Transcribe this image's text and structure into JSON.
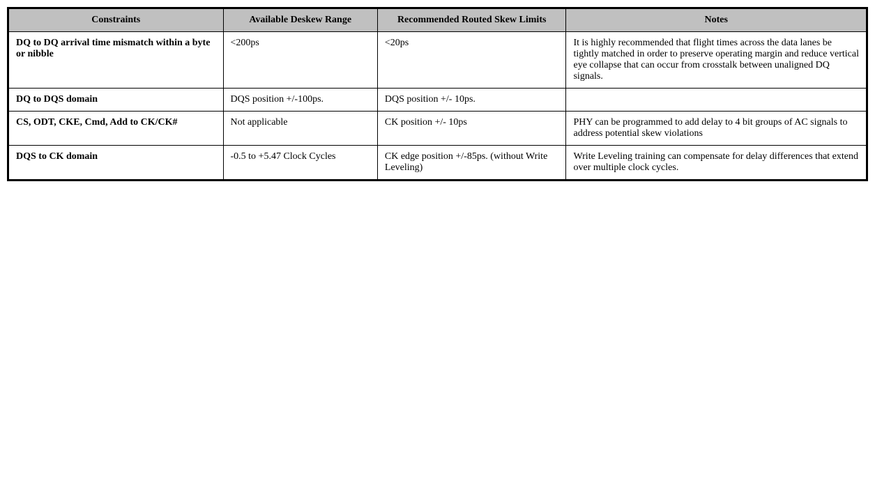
{
  "table": {
    "headers": [
      {
        "id": "constraints",
        "label": "Constraints"
      },
      {
        "id": "deskew",
        "label": "Available Deskew Range"
      },
      {
        "id": "skew",
        "label": "Recommended Routed Skew Limits"
      },
      {
        "id": "notes",
        "label": "Notes"
      }
    ],
    "rows": [
      {
        "constraint": "DQ to DQ arrival time mismatch within a byte or nibble",
        "deskew": "<200ps",
        "skew": "<20ps",
        "notes": "It is highly recommended that flight times across the data lanes be tightly matched in order to preserve operating margin and reduce vertical eye collapse that can occur from crosstalk between unaligned DQ signals."
      },
      {
        "constraint": "DQ to DQS domain",
        "deskew": "DQS position +/-100ps.",
        "skew": "DQS position +/- 10ps.",
        "notes": ""
      },
      {
        "constraint": "CS, ODT, CKE, Cmd, Add to CK/CK#",
        "deskew": "Not applicable",
        "skew": "CK position +/- 10ps",
        "notes": "PHY can be programmed to add delay to 4 bit groups of AC signals to address potential skew violations"
      },
      {
        "constraint": "DQS to CK domain",
        "deskew": "-0.5 to +5.47 Clock Cycles",
        "skew": "CK edge position +/-85ps. (without Write Leveling)",
        "notes": "Write Leveling training can compensate for delay differences that extend over multiple clock cycles."
      }
    ]
  }
}
